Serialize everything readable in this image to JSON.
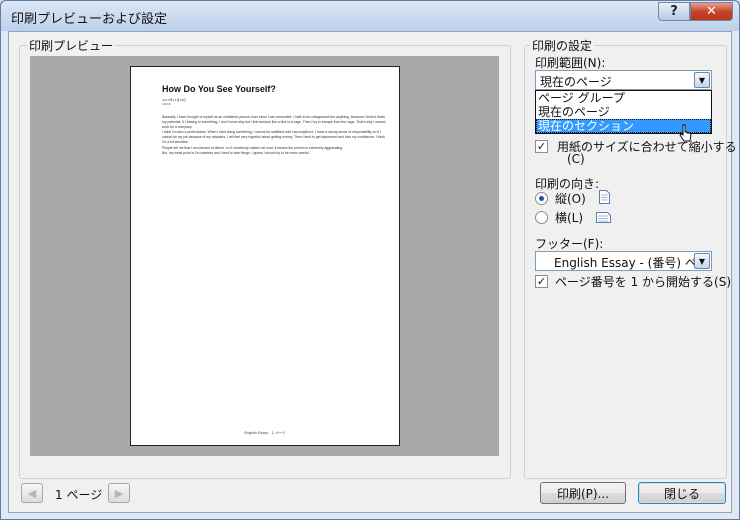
{
  "window": {
    "title": "印刷プレビューおよび設定",
    "help_glyph": "?",
    "close_glyph": "✕"
  },
  "preview": {
    "group_label": "印刷プレビュー",
    "document": {
      "title": "How Do You See Yourself?",
      "date_lines": [
        "2013年11月18日",
        "19:16"
      ],
      "paragraphs": [
        "Basically, I have thought of myself as an unfaltered person, ever since I can remember. I hate to be categorized into anything, because I think it limits my potential. If I belong to something, I don't know why but I feel anxious like a bird in a cage. Then I try to escape from the cage. That's why I cannot work for a company.",
        "I think I'm also a perfectionist. When I start doing something, I cannot be satisfied until I accomplish it. I have a strong sense of responsibility so if I cannot do my job because of my mistakes, I will feel very regretful about getting money. Then I tend to get depressed and lose my confidence. I think I'm a bit sensitive.",
        "People tell me that I am tolerant of others, so if somebody makes me mad, it means the person is extremely aggravating.",
        "But, my weak point is I'm careless and I tend to lose things. I guess I should try to be more careful."
      ],
      "footer": "English Essay - 1 ページ"
    }
  },
  "settings": {
    "group_label": "印刷の設定",
    "range": {
      "label": "印刷範囲(N):",
      "selected": "現在のページ",
      "options": [
        "ページ グループ",
        "現在のページ",
        "現在のセクション"
      ],
      "highlighted_index": 2
    },
    "fit_to_paper": {
      "label_line1": "用紙のサイズに合わせて縮小する",
      "label_line2": "(C)",
      "checked": true
    },
    "orientation": {
      "label": "印刷の向き:",
      "portrait": "縦(O)",
      "landscape": "横(L)",
      "selected": "portrait"
    },
    "footer": {
      "label": "フッター(F):",
      "value": "English Essay - (番号) ペー"
    },
    "start_page": {
      "label": "ページ番号を 1 から開始する(S)",
      "checked": true
    }
  },
  "navigation": {
    "page_label": "1 ページ",
    "prev_glyph": "◀",
    "next_glyph": "▶"
  },
  "buttons": {
    "print": "印刷(P)...",
    "close": "閉じる"
  },
  "icons": {
    "checkmark": "✓",
    "dropdown_arrow": "▼"
  }
}
